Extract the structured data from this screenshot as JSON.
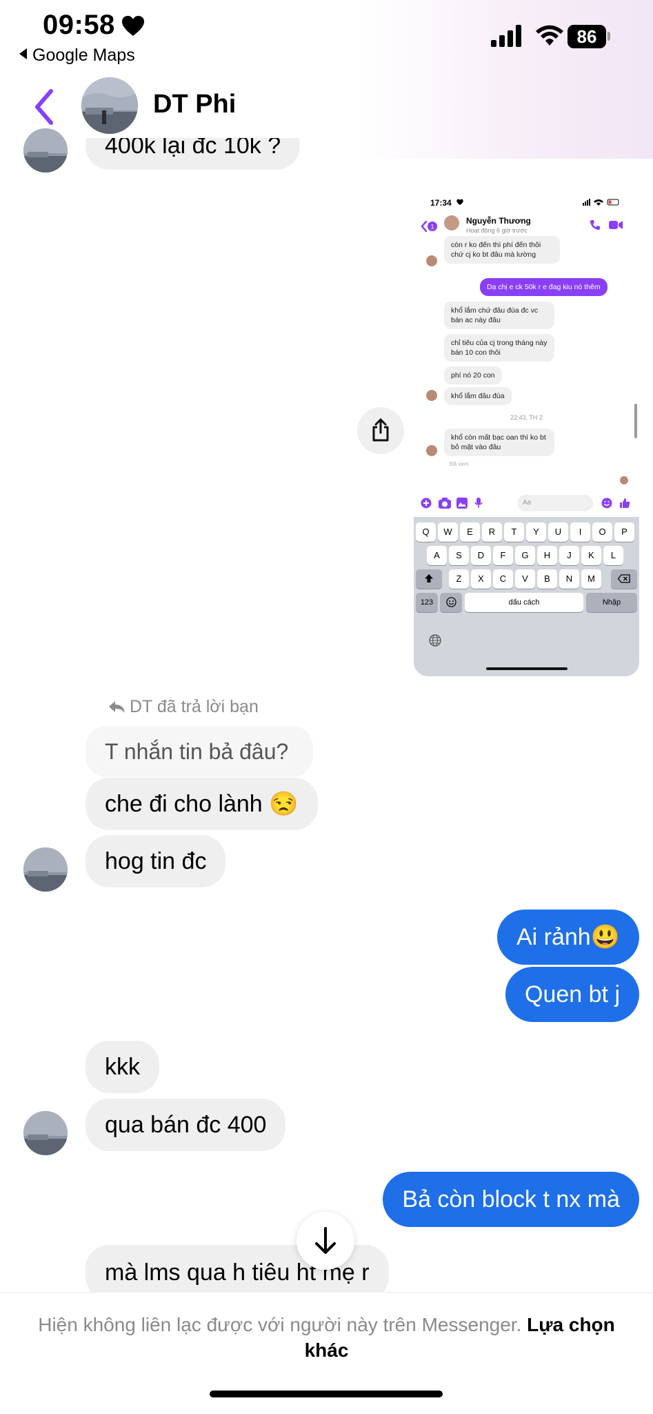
{
  "status_bar": {
    "time": "09:58",
    "back_app_label": "Google Maps",
    "battery": "86"
  },
  "header": {
    "contact_name": "DT Phi"
  },
  "messages": {
    "top_partial": "400k lại đc 10k ?",
    "reply_note": "DT đã trả lời bạn",
    "quoted": "T nhắn tin bả đâu?",
    "m1": "che đi cho lành 😒",
    "m2": "hog tin đc",
    "out1": "Ai rảnh😃",
    "out2": "Quen bt j",
    "m3": "kkk",
    "m4": "qua bán đc 400",
    "out3": "Bả còn block t nx mà",
    "m5": "mà lms qua h tiêu ht mẹ r"
  },
  "embedded_screenshot": {
    "time": "17:34",
    "contact_name": "Nguyễn Thương",
    "active_status": "Hoạt động 6 giờ trước",
    "msg1": "còn r ko đến thì phí đến thôi chứ cj ko bt đâu mà lường",
    "msg_out": "Dạ chị e ck 50k r e đag kiu nó thêm",
    "msg2": "khổ lắm chứ đâu đùa đc vc bán ac này đâu",
    "msg3": "chỉ tiêu của cj trong tháng này bán 10 con thôi",
    "msg4": "phí nó 20 con",
    "msg5": "khổ lắm đâu đùa",
    "timestamp": "22:43, TH 2",
    "msg6": "khổ còn mất bạc oan thì ko bt bỏ mặt vào đâu",
    "seen": "Đã xem",
    "compose_placeholder": "Aa",
    "keyboard": {
      "row1": [
        "Q",
        "W",
        "E",
        "R",
        "T",
        "Y",
        "U",
        "I",
        "O",
        "P"
      ],
      "row2": [
        "A",
        "S",
        "D",
        "F",
        "G",
        "H",
        "J",
        "K",
        "L"
      ],
      "row3": [
        "Z",
        "X",
        "C",
        "V",
        "B",
        "N",
        "M"
      ],
      "num_key": "123",
      "space_key": "dấu cách",
      "return_key": "Nhập"
    }
  },
  "footer": {
    "notice": "Hiện không liên lạc được với người này trên Messenger.",
    "link": "Lựa chọn khác"
  },
  "colors": {
    "accent_purple": "#8a3ff7",
    "outgoing_blue": "#1e6fe8",
    "incoming_gray": "#efefef"
  }
}
